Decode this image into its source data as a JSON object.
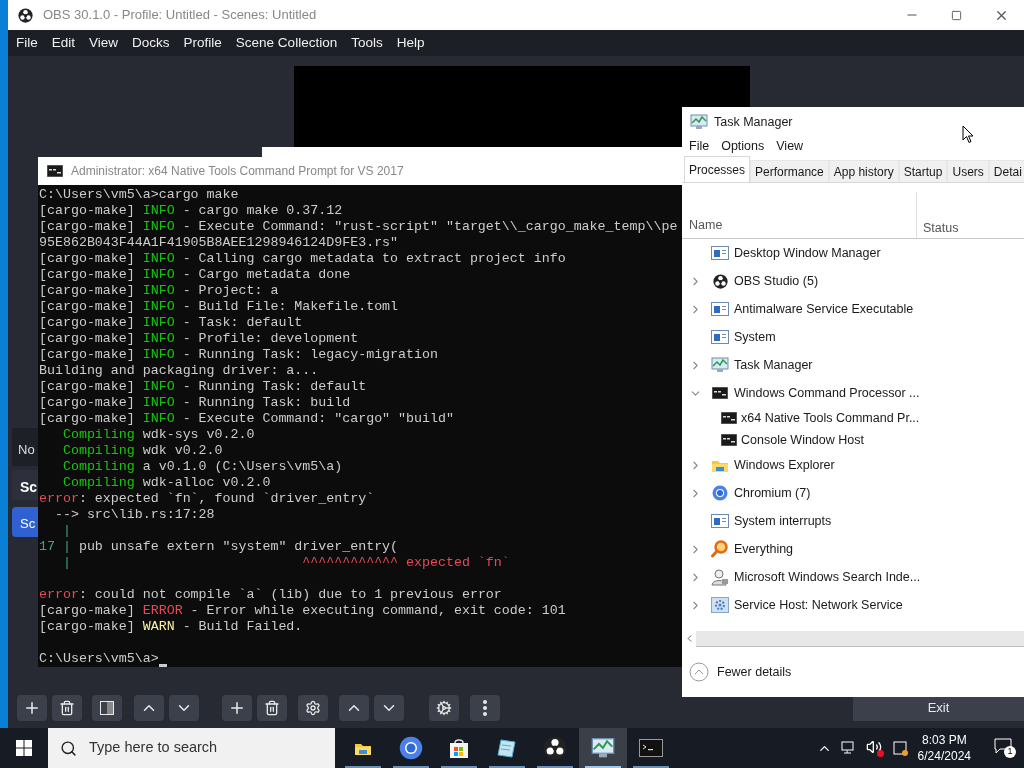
{
  "obs": {
    "title": "OBS 30.1.0 - Profile: Untitled - Scenes: Untitled",
    "menu": [
      "File",
      "Edit",
      "View",
      "Docks",
      "Profile",
      "Scene Collection",
      "Tools",
      "Help"
    ],
    "sources_fragment": "No",
    "scenes_header": "Sc",
    "scene_item": {
      "label": "Sc",
      "selected": true
    },
    "exit_button": "Exit"
  },
  "console": {
    "title": "Administrator: x64 Native Tools Command Prompt for VS 2017",
    "lines": [
      {
        "parts": [
          {
            "kind": "plain",
            "text": "C:\\Users\\vm5\\a>cargo make"
          }
        ]
      },
      {
        "parts": [
          {
            "kind": "plain",
            "text": "[cargo-make] "
          },
          {
            "kind": "info",
            "text": "INFO"
          },
          {
            "kind": "plain",
            "text": " - cargo make 0.37.12"
          }
        ]
      },
      {
        "parts": [
          {
            "kind": "plain",
            "text": "[cargo-make] "
          },
          {
            "kind": "info",
            "text": "INFO"
          },
          {
            "kind": "plain",
            "text": " - Execute Command: \"rust-script\" \"target\\\\_cargo_make_temp\\\\pe"
          }
        ]
      },
      {
        "parts": [
          {
            "kind": "plain",
            "text": "95E862B043F44A1F41905B8AEE1298946124D9FE3.rs\""
          }
        ]
      },
      {
        "parts": [
          {
            "kind": "plain",
            "text": "[cargo-make] "
          },
          {
            "kind": "info",
            "text": "INFO"
          },
          {
            "kind": "plain",
            "text": " - Calling cargo metadata to extract project info"
          }
        ]
      },
      {
        "parts": [
          {
            "kind": "plain",
            "text": "[cargo-make] "
          },
          {
            "kind": "info",
            "text": "INFO"
          },
          {
            "kind": "plain",
            "text": " - Cargo metadata done"
          }
        ]
      },
      {
        "parts": [
          {
            "kind": "plain",
            "text": "[cargo-make] "
          },
          {
            "kind": "info",
            "text": "INFO"
          },
          {
            "kind": "plain",
            "text": " - Project: a"
          }
        ]
      },
      {
        "parts": [
          {
            "kind": "plain",
            "text": "[cargo-make] "
          },
          {
            "kind": "info",
            "text": "INFO"
          },
          {
            "kind": "plain",
            "text": " - Build File: Makefile.toml"
          }
        ]
      },
      {
        "parts": [
          {
            "kind": "plain",
            "text": "[cargo-make] "
          },
          {
            "kind": "info",
            "text": "INFO"
          },
          {
            "kind": "plain",
            "text": " - Task: default"
          }
        ]
      },
      {
        "parts": [
          {
            "kind": "plain",
            "text": "[cargo-make] "
          },
          {
            "kind": "info",
            "text": "INFO"
          },
          {
            "kind": "plain",
            "text": " - Profile: development"
          }
        ]
      },
      {
        "parts": [
          {
            "kind": "plain",
            "text": "[cargo-make] "
          },
          {
            "kind": "info",
            "text": "INFO"
          },
          {
            "kind": "plain",
            "text": " - Running Task: legacy-migration"
          }
        ]
      },
      {
        "parts": [
          {
            "kind": "plain",
            "text": "Building and packaging driver: a..."
          }
        ]
      },
      {
        "parts": [
          {
            "kind": "plain",
            "text": "[cargo-make] "
          },
          {
            "kind": "info",
            "text": "INFO"
          },
          {
            "kind": "plain",
            "text": " - Running Task: default"
          }
        ]
      },
      {
        "parts": [
          {
            "kind": "plain",
            "text": "[cargo-make] "
          },
          {
            "kind": "info",
            "text": "INFO"
          },
          {
            "kind": "plain",
            "text": " - Running Task: build"
          }
        ]
      },
      {
        "parts": [
          {
            "kind": "plain",
            "text": "[cargo-make] "
          },
          {
            "kind": "info",
            "text": "INFO"
          },
          {
            "kind": "plain",
            "text": " - Execute Command: \"cargo\" \"build\""
          }
        ]
      },
      {
        "parts": [
          {
            "kind": "info",
            "text": "   Compiling"
          },
          {
            "kind": "plain",
            "text": " wdk-sys v0.2.0"
          }
        ]
      },
      {
        "parts": [
          {
            "kind": "info",
            "text": "   Compiling"
          },
          {
            "kind": "plain",
            "text": " wdk v0.2.0"
          }
        ]
      },
      {
        "parts": [
          {
            "kind": "info",
            "text": "   Compiling"
          },
          {
            "kind": "plain",
            "text": " a v0.1.0 (C:\\Users\\vm5\\a)"
          }
        ]
      },
      {
        "parts": [
          {
            "kind": "info",
            "text": "   Compiling"
          },
          {
            "kind": "plain",
            "text": " wdk-alloc v0.2.0"
          }
        ]
      },
      {
        "parts": [
          {
            "kind": "error",
            "text": "error"
          },
          {
            "kind": "plain",
            "text": ": expected `fn`, found `driver_entry`"
          }
        ]
      },
      {
        "parts": [
          {
            "kind": "plain",
            "text": "  --> src\\lib.rs:17:28"
          }
        ]
      },
      {
        "parts": [
          {
            "kind": "gutter",
            "text": "   |"
          }
        ]
      },
      {
        "parts": [
          {
            "kind": "gutter",
            "text": "17 |"
          },
          {
            "kind": "plain",
            "text": " pub unsafe extern \"system\" driver_entry("
          }
        ]
      },
      {
        "parts": [
          {
            "kind": "gutter",
            "text": "   |"
          },
          {
            "kind": "error",
            "text": "                             ^^^^^^^^^^^^ expected `fn`"
          }
        ]
      },
      {
        "space_before": true,
        "parts": [
          {
            "kind": "error",
            "text": "error"
          },
          {
            "kind": "plain",
            "text": ": could not compile `a` (lib) due to 1 previous error"
          }
        ]
      },
      {
        "parts": [
          {
            "kind": "plain",
            "text": "[cargo-make] "
          },
          {
            "kind": "error",
            "text": "ERROR"
          },
          {
            "kind": "plain",
            "text": " - Error while executing command, exit code: 101"
          }
        ]
      },
      {
        "parts": [
          {
            "kind": "plain",
            "text": "[cargo-make] "
          },
          {
            "kind": "warn",
            "text": "WARN"
          },
          {
            "kind": "plain",
            "text": " - Build Failed."
          }
        ]
      },
      {
        "space_before": true,
        "parts": [
          {
            "kind": "plain",
            "text": "C:\\Users\\vm5\\a>"
          }
        ],
        "cursor": true
      }
    ]
  },
  "task_manager": {
    "title": "Task Manager",
    "menu": [
      "File",
      "Options",
      "View"
    ],
    "tabs": [
      {
        "label": "Processes",
        "selected": true
      },
      {
        "label": "Performance",
        "selected": false
      },
      {
        "label": "App history",
        "selected": false
      },
      {
        "label": "Startup",
        "selected": false
      },
      {
        "label": "Users",
        "selected": false
      },
      {
        "label": "Detai",
        "selected": false
      }
    ],
    "columns": [
      "Name",
      "Status"
    ],
    "rows": [
      {
        "name": "Desktop Window Manager",
        "kind": "service"
      },
      {
        "name": "OBS Studio (5)",
        "kind": "obs",
        "expanded": false
      },
      {
        "name": "Antimalware Service Executable",
        "kind": "service",
        "expanded": false
      },
      {
        "name": "System",
        "kind": "service"
      },
      {
        "name": "Task Manager",
        "kind": "taskmgr",
        "expanded": false
      },
      {
        "name": "Windows Command Processor ...",
        "kind": "console",
        "expanded": true,
        "children": [
          {
            "name": "x64 Native Tools Command Pr...",
            "kind": "console"
          },
          {
            "name": "Console Window Host",
            "kind": "console"
          }
        ]
      },
      {
        "name": "Windows Explorer",
        "kind": "explorer",
        "expanded": false
      },
      {
        "name": "Chromium (7)",
        "kind": "chromium",
        "expanded": false
      },
      {
        "name": "System interrupts",
        "kind": "service"
      },
      {
        "name": "Everything",
        "kind": "everything",
        "expanded": false
      },
      {
        "name": "Microsoft Windows Search Inde...",
        "kind": "searchindexer",
        "expanded": false
      },
      {
        "name": "Service Host: Network Service",
        "kind": "gear",
        "expanded": false
      }
    ],
    "fewer_details": "Fewer details"
  },
  "taskbar": {
    "search_placeholder": "Type here to search",
    "apps": [
      {
        "kind": "explorer",
        "selected": false
      },
      {
        "kind": "chromium",
        "selected": false
      },
      {
        "kind": "store",
        "selected": false
      },
      {
        "kind": "notepad",
        "selected": false
      },
      {
        "kind": "obs",
        "selected": false
      },
      {
        "kind": "taskmgr",
        "selected": true
      },
      {
        "kind": "console",
        "selected": false
      }
    ],
    "time": "8:03 PM",
    "date": "6/24/2024",
    "notifications": "1"
  }
}
